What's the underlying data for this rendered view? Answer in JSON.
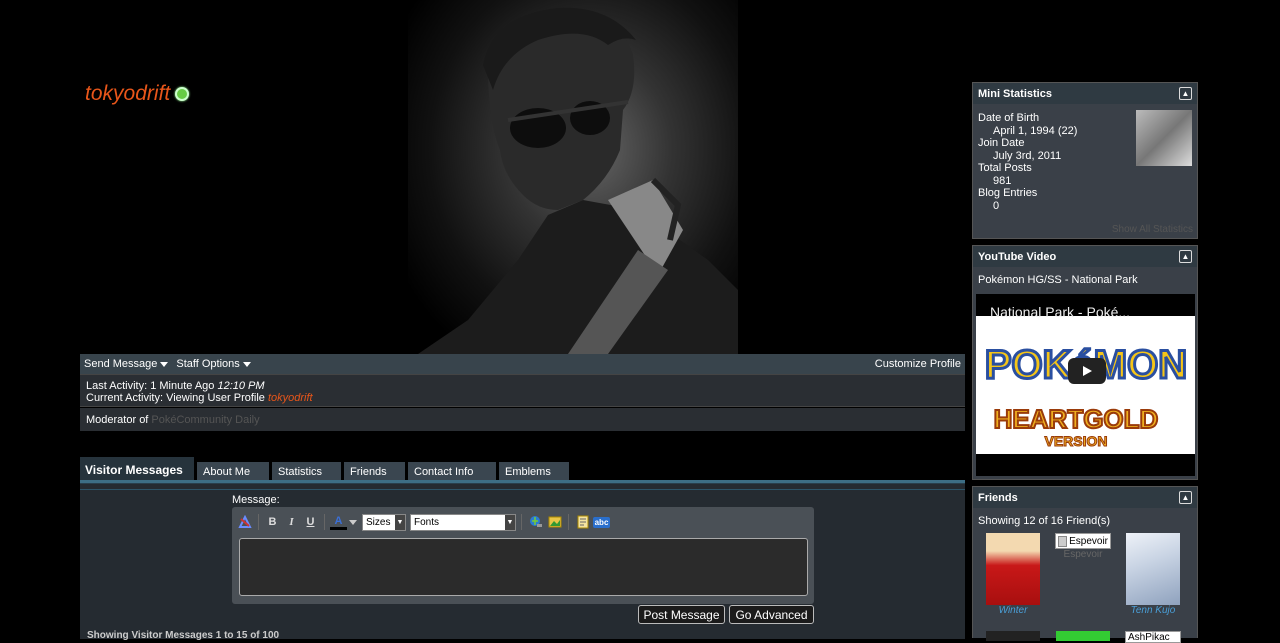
{
  "user": {
    "name": "tokyodrift"
  },
  "nav": {
    "send_message": "Send Message",
    "staff_options": "Staff Options",
    "customize": "Customize Profile"
  },
  "activity": {
    "last_label": "Last Activity: 1 Minute Ago",
    "last_time": "12:10 PM",
    "current_label": "Current Activity: Viewing User Profile",
    "current_user": "tokyodrift",
    "moderator_label": "Moderator of",
    "moderator_forum": "PokéCommunity Daily"
  },
  "tabs": [
    "Visitor Messages",
    "About Me",
    "Statistics",
    "Friends",
    "Contact Info",
    "Emblems"
  ],
  "editor": {
    "label": "Message:",
    "bold": "B",
    "italic": "I",
    "underline": "U",
    "font_color": "A",
    "sizes": "Sizes",
    "fonts": "Fonts",
    "spell": "abc"
  },
  "buttons": {
    "post": "Post Message",
    "advanced": "Go Advanced"
  },
  "vm_footer": "Showing Visitor Messages 1 to 15 of 100",
  "mini_stats": {
    "title": "Mini Statistics",
    "dob_label": "Date of Birth",
    "dob": "April 1, 1994 (22)",
    "join_label": "Join Date",
    "join": "July 3rd, 2011",
    "posts_label": "Total Posts",
    "posts": "981",
    "blog_label": "Blog Entries",
    "blog": "0",
    "show_all": "Show All Statistics"
  },
  "youtube": {
    "title": "YouTube Video",
    "video_name": "Pokémon HG/SS - National Park",
    "overlay_title": "National Park - Poké..."
  },
  "friends": {
    "title": "Friends",
    "showing": "Showing 12 of 16 Friend(s)",
    "list": [
      {
        "name": "Winter"
      },
      {
        "name": "Espevoir"
      },
      {
        "name": "Tenn Kujo"
      }
    ],
    "row2_broken": "AshPikac"
  },
  "colors": {
    "accent": "#e8561a",
    "link_blue": "#4a9fd8",
    "bar": "#38444c",
    "panel": "#2a2e33"
  }
}
